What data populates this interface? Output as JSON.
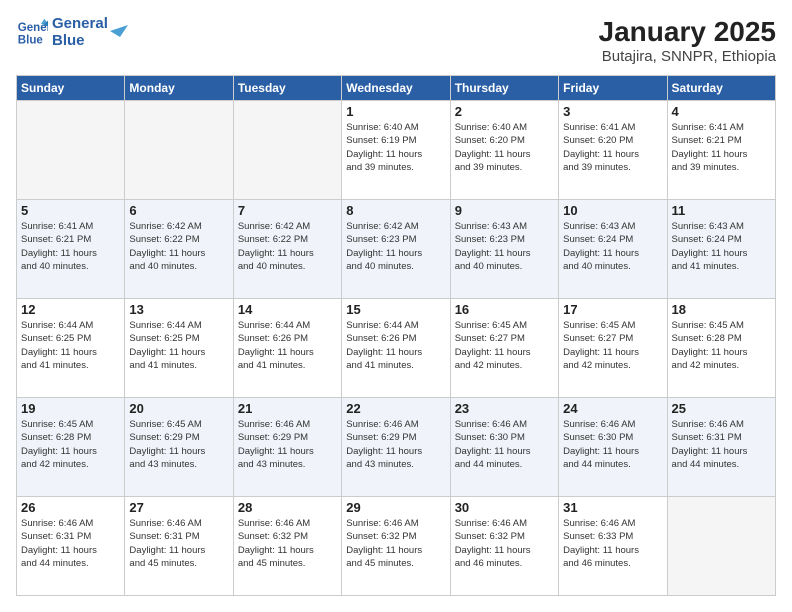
{
  "logo": {
    "name": "GeneralBlue",
    "line1": "General",
    "line2": "Blue"
  },
  "title": "January 2025",
  "subtitle": "Butajira, SNNPR, Ethiopia",
  "weekdays": [
    "Sunday",
    "Monday",
    "Tuesday",
    "Wednesday",
    "Thursday",
    "Friday",
    "Saturday"
  ],
  "weeks": [
    [
      {
        "day": "",
        "info": ""
      },
      {
        "day": "",
        "info": ""
      },
      {
        "day": "",
        "info": ""
      },
      {
        "day": "1",
        "info": "Sunrise: 6:40 AM\nSunset: 6:19 PM\nDaylight: 11 hours\nand 39 minutes."
      },
      {
        "day": "2",
        "info": "Sunrise: 6:40 AM\nSunset: 6:20 PM\nDaylight: 11 hours\nand 39 minutes."
      },
      {
        "day": "3",
        "info": "Sunrise: 6:41 AM\nSunset: 6:20 PM\nDaylight: 11 hours\nand 39 minutes."
      },
      {
        "day": "4",
        "info": "Sunrise: 6:41 AM\nSunset: 6:21 PM\nDaylight: 11 hours\nand 39 minutes."
      }
    ],
    [
      {
        "day": "5",
        "info": "Sunrise: 6:41 AM\nSunset: 6:21 PM\nDaylight: 11 hours\nand 40 minutes."
      },
      {
        "day": "6",
        "info": "Sunrise: 6:42 AM\nSunset: 6:22 PM\nDaylight: 11 hours\nand 40 minutes."
      },
      {
        "day": "7",
        "info": "Sunrise: 6:42 AM\nSunset: 6:22 PM\nDaylight: 11 hours\nand 40 minutes."
      },
      {
        "day": "8",
        "info": "Sunrise: 6:42 AM\nSunset: 6:23 PM\nDaylight: 11 hours\nand 40 minutes."
      },
      {
        "day": "9",
        "info": "Sunrise: 6:43 AM\nSunset: 6:23 PM\nDaylight: 11 hours\nand 40 minutes."
      },
      {
        "day": "10",
        "info": "Sunrise: 6:43 AM\nSunset: 6:24 PM\nDaylight: 11 hours\nand 40 minutes."
      },
      {
        "day": "11",
        "info": "Sunrise: 6:43 AM\nSunset: 6:24 PM\nDaylight: 11 hours\nand 41 minutes."
      }
    ],
    [
      {
        "day": "12",
        "info": "Sunrise: 6:44 AM\nSunset: 6:25 PM\nDaylight: 11 hours\nand 41 minutes."
      },
      {
        "day": "13",
        "info": "Sunrise: 6:44 AM\nSunset: 6:25 PM\nDaylight: 11 hours\nand 41 minutes."
      },
      {
        "day": "14",
        "info": "Sunrise: 6:44 AM\nSunset: 6:26 PM\nDaylight: 11 hours\nand 41 minutes."
      },
      {
        "day": "15",
        "info": "Sunrise: 6:44 AM\nSunset: 6:26 PM\nDaylight: 11 hours\nand 41 minutes."
      },
      {
        "day": "16",
        "info": "Sunrise: 6:45 AM\nSunset: 6:27 PM\nDaylight: 11 hours\nand 42 minutes."
      },
      {
        "day": "17",
        "info": "Sunrise: 6:45 AM\nSunset: 6:27 PM\nDaylight: 11 hours\nand 42 minutes."
      },
      {
        "day": "18",
        "info": "Sunrise: 6:45 AM\nSunset: 6:28 PM\nDaylight: 11 hours\nand 42 minutes."
      }
    ],
    [
      {
        "day": "19",
        "info": "Sunrise: 6:45 AM\nSunset: 6:28 PM\nDaylight: 11 hours\nand 42 minutes."
      },
      {
        "day": "20",
        "info": "Sunrise: 6:45 AM\nSunset: 6:29 PM\nDaylight: 11 hours\nand 43 minutes."
      },
      {
        "day": "21",
        "info": "Sunrise: 6:46 AM\nSunset: 6:29 PM\nDaylight: 11 hours\nand 43 minutes."
      },
      {
        "day": "22",
        "info": "Sunrise: 6:46 AM\nSunset: 6:29 PM\nDaylight: 11 hours\nand 43 minutes."
      },
      {
        "day": "23",
        "info": "Sunrise: 6:46 AM\nSunset: 6:30 PM\nDaylight: 11 hours\nand 44 minutes."
      },
      {
        "day": "24",
        "info": "Sunrise: 6:46 AM\nSunset: 6:30 PM\nDaylight: 11 hours\nand 44 minutes."
      },
      {
        "day": "25",
        "info": "Sunrise: 6:46 AM\nSunset: 6:31 PM\nDaylight: 11 hours\nand 44 minutes."
      }
    ],
    [
      {
        "day": "26",
        "info": "Sunrise: 6:46 AM\nSunset: 6:31 PM\nDaylight: 11 hours\nand 44 minutes."
      },
      {
        "day": "27",
        "info": "Sunrise: 6:46 AM\nSunset: 6:31 PM\nDaylight: 11 hours\nand 45 minutes."
      },
      {
        "day": "28",
        "info": "Sunrise: 6:46 AM\nSunset: 6:32 PM\nDaylight: 11 hours\nand 45 minutes."
      },
      {
        "day": "29",
        "info": "Sunrise: 6:46 AM\nSunset: 6:32 PM\nDaylight: 11 hours\nand 45 minutes."
      },
      {
        "day": "30",
        "info": "Sunrise: 6:46 AM\nSunset: 6:32 PM\nDaylight: 11 hours\nand 46 minutes."
      },
      {
        "day": "31",
        "info": "Sunrise: 6:46 AM\nSunset: 6:33 PM\nDaylight: 11 hours\nand 46 minutes."
      },
      {
        "day": "",
        "info": ""
      }
    ]
  ]
}
